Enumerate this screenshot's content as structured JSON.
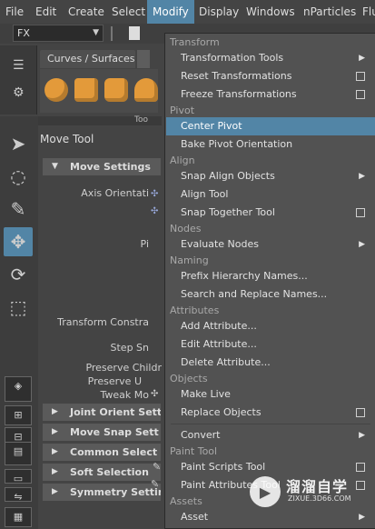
{
  "menubar": {
    "items": [
      "File",
      "Edit",
      "Create",
      "Select",
      "Modify",
      "Display",
      "Windows",
      "nParticles",
      "Flu"
    ],
    "active": "Modify"
  },
  "toolbar": {
    "fx_value": "FX"
  },
  "shelf": {
    "tab_label": "Curves / Surfaces"
  },
  "tool_settings": {
    "title": "Move Tool",
    "header_fragment": "Too",
    "sections": [
      "Move Settings",
      "Joint Orient Sett",
      "Move Snap Sett",
      "Common Select",
      "Soft Selection",
      "Symmetry Settin"
    ],
    "labels": [
      "Axis Orientati",
      "Pi",
      "Transform Constra",
      "Step Sn",
      "Preserve Childr",
      "Preserve U",
      "Tweak Mo"
    ]
  },
  "menu": {
    "sections": {
      "transform": "Transform",
      "pivot": "Pivot",
      "align": "Align",
      "nodes": "Nodes",
      "naming": "Naming",
      "attributes": "Attributes",
      "objects": "Objects",
      "paint_tool": "Paint Tool",
      "assets": "Assets"
    },
    "items": {
      "transformation_tools": "Transformation Tools",
      "reset_transformations": "Reset Transformations",
      "freeze_transformations": "Freeze Transformations",
      "center_pivot": "Center Pivot",
      "bake_pivot": "Bake Pivot Orientation",
      "snap_align": "Snap Align Objects",
      "align_tool": "Align Tool",
      "snap_together": "Snap Together Tool",
      "evaluate_nodes": "Evaluate Nodes",
      "prefix_hierarchy": "Prefix Hierarchy Names...",
      "search_replace": "Search and Replace Names...",
      "add_attribute": "Add Attribute...",
      "edit_attribute": "Edit Attribute...",
      "delete_attribute": "Delete Attribute...",
      "make_live": "Make Live",
      "replace_objects": "Replace Objects",
      "convert": "Convert",
      "paint_scripts": "Paint Scripts Tool",
      "paint_attributes": "Paint Attributes Tool",
      "asset": "Asset"
    },
    "highlighted": "Center Pivot"
  },
  "watermark": {
    "title": "溜溜自学",
    "url": "ZIXUE.3D66.COM"
  },
  "colors": {
    "accent": "#5285a6",
    "menu_bg": "#525252",
    "ui_bg": "#444444"
  }
}
